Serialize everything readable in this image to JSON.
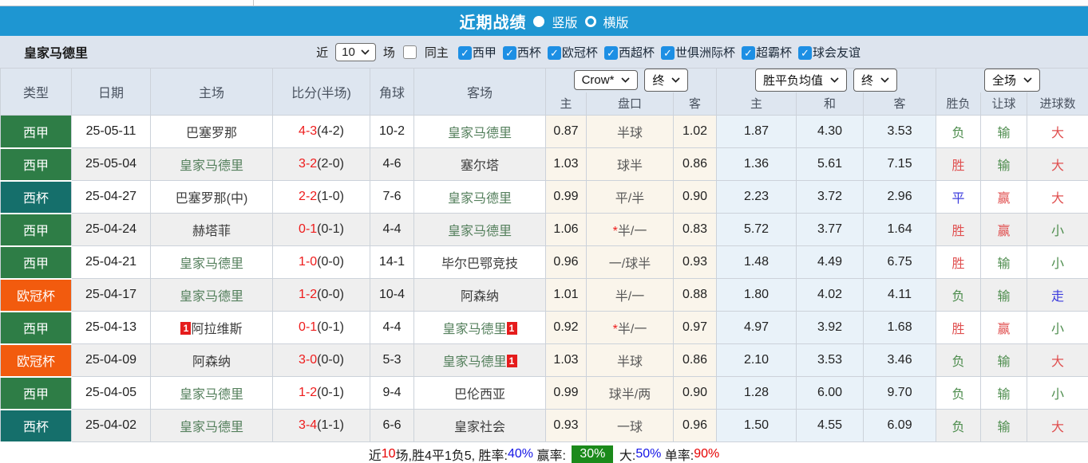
{
  "title_bar": {
    "title": "近期战绩",
    "radio_vertical_label": "竖版",
    "radio_horizontal_label": "横版",
    "selected": "竖版"
  },
  "filter_bar": {
    "team_name": "皇家马德里",
    "near_label": "近",
    "matches_value": "10",
    "matches_label": "场",
    "same_home_label": "同主",
    "same_home_checked": false,
    "leagues": [
      "西甲",
      "西杯",
      "欧冠杯",
      "西超杯",
      "世俱洲际杯",
      "超霸杯",
      "球会友谊"
    ],
    "check_glyph": "✓"
  },
  "table": {
    "headers": {
      "type": "类型",
      "date": "日期",
      "home": "主场",
      "score": "比分(半场)",
      "corner": "角球",
      "away": "客场"
    },
    "dropdowns": {
      "odds_company": "Crow*",
      "odds_time": "终",
      "avg_label": "胜平负均值",
      "avg_time": "终",
      "scope": "全场"
    },
    "sub_headers": [
      "主",
      "盘口",
      "客",
      "主",
      "和",
      "客",
      "胜负",
      "让球",
      "进球数"
    ],
    "rows": [
      {
        "type": "西甲",
        "date": "25-05-11",
        "home": "巴塞罗那",
        "home_focus": false,
        "home_rc": false,
        "score": "4-3",
        "half": "(4-2)",
        "corner": "10-2",
        "away": "皇家马德里",
        "away_focus": true,
        "away_rc": false,
        "odds_home": "0.87",
        "handicap": "半球",
        "handicap_star": false,
        "odds_away": "1.02",
        "avg_home": "1.87",
        "avg_draw": "4.30",
        "avg_away": "3.53",
        "res_wdl": "负",
        "res_wdl_color": "green",
        "res_hc": "输",
        "res_hc_color": "green",
        "res_goal": "大",
        "res_goal_color": "red"
      },
      {
        "type": "西甲",
        "date": "25-05-04",
        "home": "皇家马德里",
        "home_focus": true,
        "home_rc": false,
        "score": "3-2",
        "half": "(2-0)",
        "corner": "4-6",
        "away": "塞尔塔",
        "away_focus": false,
        "away_rc": false,
        "odds_home": "1.03",
        "handicap": "球半",
        "handicap_star": false,
        "odds_away": "0.86",
        "avg_home": "1.36",
        "avg_draw": "5.61",
        "avg_away": "7.15",
        "res_wdl": "胜",
        "res_wdl_color": "red",
        "res_hc": "输",
        "res_hc_color": "green",
        "res_goal": "大",
        "res_goal_color": "red"
      },
      {
        "type": "西杯",
        "date": "25-04-27",
        "home": "巴塞罗那(中)",
        "home_focus": false,
        "home_rc": false,
        "score": "2-2",
        "half": "(1-0)",
        "corner": "7-6",
        "away": "皇家马德里",
        "away_focus": true,
        "away_rc": false,
        "odds_home": "0.99",
        "handicap": "平/半",
        "handicap_star": false,
        "odds_away": "0.90",
        "avg_home": "2.23",
        "avg_draw": "3.72",
        "avg_away": "2.96",
        "res_wdl": "平",
        "res_wdl_color": "blue",
        "res_hc": "赢",
        "res_hc_color": "red",
        "res_goal": "大",
        "res_goal_color": "red"
      },
      {
        "type": "西甲",
        "date": "25-04-24",
        "home": "赫塔菲",
        "home_focus": false,
        "home_rc": false,
        "score": "0-1",
        "half": "(0-1)",
        "corner": "4-4",
        "away": "皇家马德里",
        "away_focus": true,
        "away_rc": false,
        "odds_home": "1.06",
        "handicap": "半/一",
        "handicap_star": true,
        "odds_away": "0.83",
        "avg_home": "5.72",
        "avg_draw": "3.77",
        "avg_away": "1.64",
        "res_wdl": "胜",
        "res_wdl_color": "red",
        "res_hc": "赢",
        "res_hc_color": "red",
        "res_goal": "小",
        "res_goal_color": "green"
      },
      {
        "type": "西甲",
        "date": "25-04-21",
        "home": "皇家马德里",
        "home_focus": true,
        "home_rc": false,
        "score": "1-0",
        "half": "(0-0)",
        "corner": "14-1",
        "away": "毕尔巴鄂竞技",
        "away_focus": false,
        "away_rc": false,
        "odds_home": "0.96",
        "handicap": "一/球半",
        "handicap_star": false,
        "odds_away": "0.93",
        "avg_home": "1.48",
        "avg_draw": "4.49",
        "avg_away": "6.75",
        "res_wdl": "胜",
        "res_wdl_color": "red",
        "res_hc": "输",
        "res_hc_color": "green",
        "res_goal": "小",
        "res_goal_color": "green"
      },
      {
        "type": "欧冠杯",
        "date": "25-04-17",
        "home": "皇家马德里",
        "home_focus": true,
        "home_rc": false,
        "score": "1-2",
        "half": "(0-0)",
        "corner": "10-4",
        "away": "阿森纳",
        "away_focus": false,
        "away_rc": false,
        "odds_home": "1.01",
        "handicap": "半/一",
        "handicap_star": false,
        "odds_away": "0.88",
        "avg_home": "1.80",
        "avg_draw": "4.02",
        "avg_away": "4.11",
        "res_wdl": "负",
        "res_wdl_color": "green",
        "res_hc": "输",
        "res_hc_color": "green",
        "res_goal": "走",
        "res_goal_color": "blue"
      },
      {
        "type": "西甲",
        "date": "25-04-13",
        "home": "阿拉维斯",
        "home_focus": false,
        "home_rc": true,
        "score": "0-1",
        "half": "(0-1)",
        "corner": "4-4",
        "away": "皇家马德里",
        "away_focus": true,
        "away_rc": true,
        "odds_home": "0.92",
        "handicap": "半/一",
        "handicap_star": true,
        "odds_away": "0.97",
        "avg_home": "4.97",
        "avg_draw": "3.92",
        "avg_away": "1.68",
        "res_wdl": "胜",
        "res_wdl_color": "red",
        "res_hc": "赢",
        "res_hc_color": "red",
        "res_goal": "小",
        "res_goal_color": "green"
      },
      {
        "type": "欧冠杯",
        "date": "25-04-09",
        "home": "阿森纳",
        "home_focus": false,
        "home_rc": false,
        "score": "3-0",
        "half": "(0-0)",
        "corner": "5-3",
        "away": "皇家马德里",
        "away_focus": true,
        "away_rc": true,
        "odds_home": "1.03",
        "handicap": "半球",
        "handicap_star": false,
        "odds_away": "0.86",
        "avg_home": "2.10",
        "avg_draw": "3.53",
        "avg_away": "3.46",
        "res_wdl": "负",
        "res_wdl_color": "green",
        "res_hc": "输",
        "res_hc_color": "green",
        "res_goal": "大",
        "res_goal_color": "red"
      },
      {
        "type": "西甲",
        "date": "25-04-05",
        "home": "皇家马德里",
        "home_focus": true,
        "home_rc": false,
        "score": "1-2",
        "half": "(0-1)",
        "corner": "9-4",
        "away": "巴伦西亚",
        "away_focus": false,
        "away_rc": false,
        "odds_home": "0.99",
        "handicap": "球半/两",
        "handicap_star": false,
        "odds_away": "0.90",
        "avg_home": "1.28",
        "avg_draw": "6.00",
        "avg_away": "9.70",
        "res_wdl": "负",
        "res_wdl_color": "green",
        "res_hc": "输",
        "res_hc_color": "green",
        "res_goal": "小",
        "res_goal_color": "green"
      },
      {
        "type": "西杯",
        "date": "25-04-02",
        "home": "皇家马德里",
        "home_focus": true,
        "home_rc": false,
        "score": "3-4",
        "half": "(1-1)",
        "corner": "6-6",
        "away": "皇家社会",
        "away_focus": false,
        "away_rc": false,
        "odds_home": "0.93",
        "handicap": "一球",
        "handicap_star": false,
        "odds_away": "0.96",
        "avg_home": "1.50",
        "avg_draw": "4.55",
        "avg_away": "6.09",
        "res_wdl": "负",
        "res_wdl_color": "green",
        "res_hc": "输",
        "res_hc_color": "green",
        "res_goal": "大",
        "res_goal_color": "red"
      }
    ],
    "redcard_badge": "1"
  },
  "summary": {
    "segments": [
      {
        "text": "近",
        "style": "plain"
      },
      {
        "text": "10",
        "style": "red"
      },
      {
        "text": "场,胜4平1负5, 胜率:",
        "style": "plain"
      },
      {
        "text": "40%",
        "style": "blue"
      },
      {
        "text": " 赢率: ",
        "style": "plain"
      },
      {
        "text": "30%",
        "style": "green-badge"
      },
      {
        "text": " 大:",
        "style": "plain"
      },
      {
        "text": "50%",
        "style": "blue"
      },
      {
        "text": " 单率:",
        "style": "plain"
      },
      {
        "text": "90%",
        "style": "red"
      }
    ]
  },
  "colors": {
    "title_bar_bg": "#1e96d2",
    "filter_bar_bg": "#dde4ee",
    "header_bg": "#dee6f0",
    "checkbox_blue": "#1d8fe4",
    "league_colors": {
      "西甲": "#2e7d46",
      "西杯": "#156f6b",
      "欧冠杯": "#f25b0e"
    },
    "score_red": "#ee1c1c",
    "focus_team_green": "#55805d",
    "result_red": "#e05050",
    "result_green": "#4e8d4e",
    "result_blue": "#3c3cdd",
    "summary_badge_green": "#1b8a1b",
    "odds_col_bg": "#faf5eb",
    "avg_col_bg": "#e9f2f9"
  }
}
